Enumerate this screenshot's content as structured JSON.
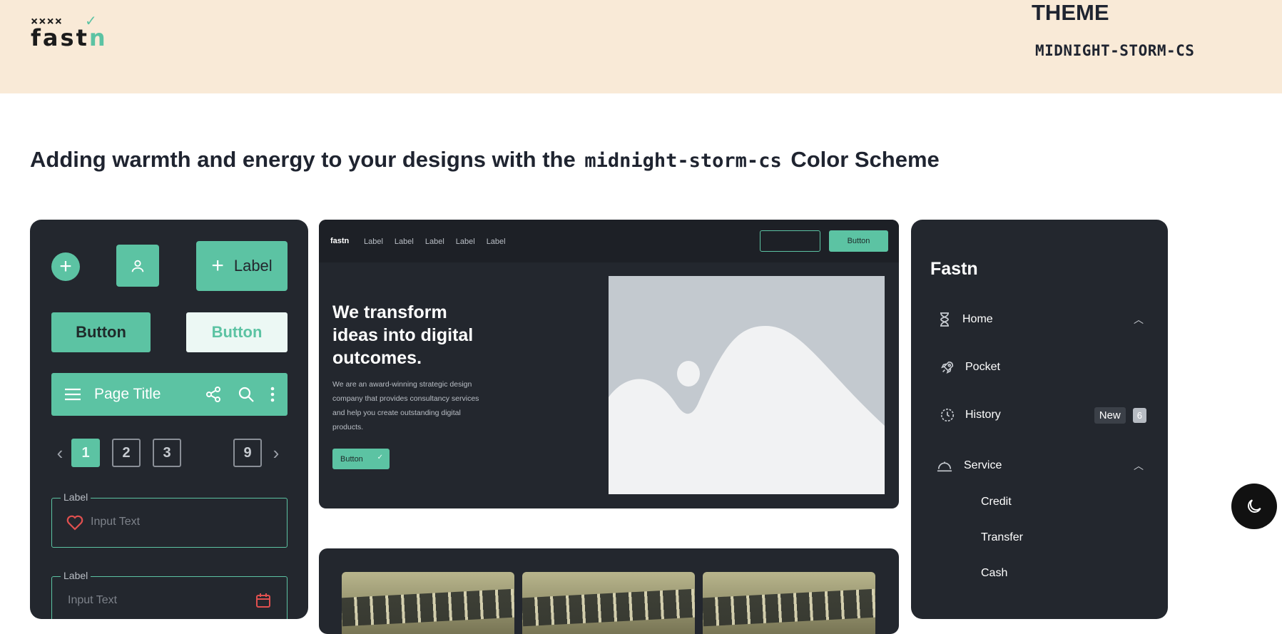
{
  "header": {
    "logo_marks": "××××",
    "logo_word": "fast",
    "logo_word_n": "n",
    "theme_label": "THEME",
    "theme_name": "MIDNIGHT-STORM-CS"
  },
  "headline": {
    "before": "Adding warmth and energy to your designs with the",
    "code": "midnight-storm-cs",
    "after": "Color Scheme"
  },
  "left_panel": {
    "label_button": "Label",
    "button_filled": "Button",
    "button_light": "Button",
    "app_bar_title": "Page Title",
    "pages": [
      "1",
      "2",
      "3",
      "9"
    ],
    "field1": {
      "label": "Label",
      "placeholder": "Input Text"
    },
    "field2": {
      "label": "Label",
      "placeholder": "Input Text"
    }
  },
  "preview": {
    "brand": "fastn",
    "nav_links": [
      "Label",
      "Label",
      "Label",
      "Label",
      "Label"
    ],
    "nav_button": "Button",
    "hero_title": "We transform ideas into digital outcomes.",
    "hero_text": "We are an award-winning strategic design company that provides consultancy services and help you create outstanding digital products.",
    "hero_button": "Button"
  },
  "sidebar": {
    "title": "Fastn",
    "items": [
      {
        "label": "Home",
        "icon": "hourglass-icon"
      },
      {
        "label": "Pocket",
        "icon": "rocket-icon"
      },
      {
        "label": "History",
        "icon": "clock-icon",
        "badge": "New",
        "count": "6"
      },
      {
        "label": "Service",
        "icon": "service-bell-icon"
      }
    ],
    "sub_items": [
      "Credit",
      "Transfer",
      "Cash"
    ]
  },
  "colors": {
    "accent": "#5cc3a3",
    "panel": "#23272e",
    "header_bg": "#f9ead7"
  }
}
